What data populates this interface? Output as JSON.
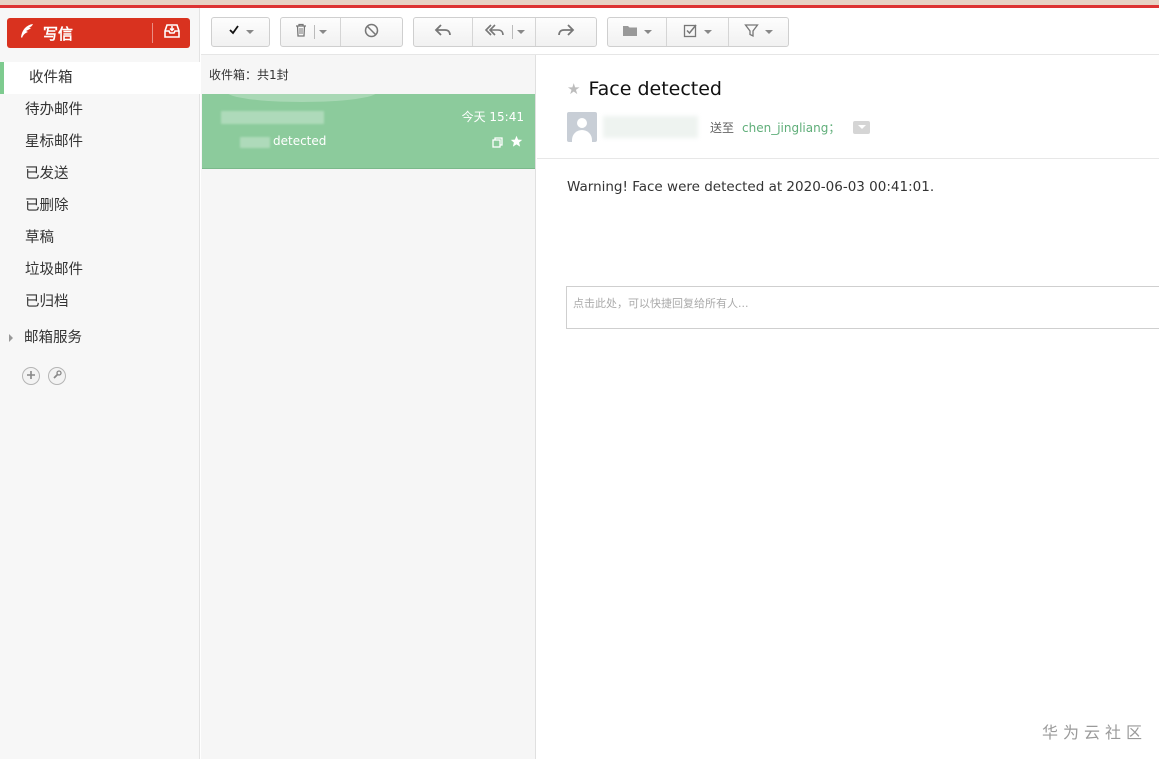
{
  "compose": {
    "label": "写信",
    "icon": "feather-icon",
    "inbox_icon": "inbox-tray-icon"
  },
  "sidebar": {
    "items": [
      {
        "label": "收件箱",
        "active": true
      },
      {
        "label": "待办邮件"
      },
      {
        "label": "星标邮件"
      },
      {
        "label": "已发送"
      },
      {
        "label": "已删除"
      },
      {
        "label": "草稿"
      },
      {
        "label": "垃圾邮件"
      },
      {
        "label": "已归档"
      }
    ],
    "service_label": "邮箱服务",
    "tools": [
      "add-icon",
      "wrench-icon"
    ]
  },
  "toolbar": {
    "groups": [
      [
        "select-check-icon"
      ],
      [
        "trash-icon",
        "block-icon"
      ],
      [
        "reply-icon",
        "reply-all-icon",
        "forward-icon"
      ],
      [
        "folder-icon",
        "mark-icon",
        "filter-icon"
      ]
    ]
  },
  "list": {
    "header": "收件箱：共1封",
    "messages": [
      {
        "date": "今天 15:41",
        "subject": "detected",
        "selected": true
      }
    ]
  },
  "reader": {
    "title": "Face detected",
    "sent_to_label": "送至",
    "to_name": "chen_jingliang；",
    "body": "Warning! Face were detected at 2020-06-03 00:41:01.",
    "quick_reply_placeholder": "点击此处，可以快捷回复给所有人..."
  },
  "watermark": "华为云社区",
  "colors": {
    "brand_red": "#d9321f",
    "accent_green": "#8ccb9c",
    "link_green": "#5fae79"
  }
}
